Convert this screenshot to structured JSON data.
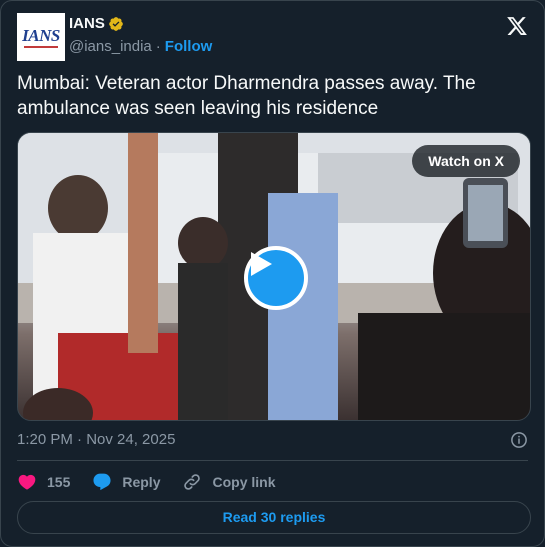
{
  "account": {
    "display_name": "IANS",
    "handle": "@ians_india",
    "separator": "·",
    "follow_label": "Follow",
    "avatar_text": "IANS"
  },
  "tweet": {
    "text": "Mumbai: Veteran actor Dharmendra passes away. The ambulance was seen leaving his residence",
    "timestamp": "1:20 PM · Nov 24, 2025"
  },
  "media": {
    "watch_label": "Watch on X"
  },
  "actions": {
    "likes": "155",
    "reply_label": "Reply",
    "copy_link_label": "Copy link"
  },
  "footer": {
    "read_replies_label": "Read 30 replies"
  },
  "colors": {
    "accent": "#1d9bf0",
    "like": "#f91880",
    "background": "#15202b",
    "verified": "#e2b719"
  },
  "icons": [
    "x-logo-icon",
    "verified-badge-icon",
    "play-icon",
    "info-icon",
    "heart-icon",
    "reply-icon",
    "link-icon"
  ]
}
